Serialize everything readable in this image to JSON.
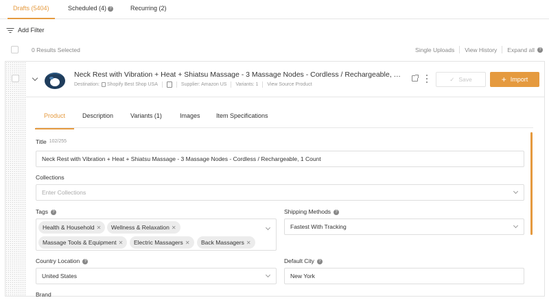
{
  "top_tabs": [
    {
      "label": "Drafts (5404)"
    },
    {
      "label": "Scheduled (4)"
    },
    {
      "label": "Recurring (2)"
    }
  ],
  "filter": {
    "label": "Add Filter"
  },
  "selection": {
    "results_text": "0 Results Selected",
    "links": [
      "Single Uploads",
      "View History",
      "Expand all"
    ]
  },
  "product": {
    "title": "Neck Rest with Vibration + Heat + Shiatsu Massage - 3 Massage Nodes - Cordless / Rechargeable, 1 C...",
    "destination_label": "Destination:",
    "destination_value": "Shopify Best Shop USA",
    "supplier": "Supplier: Amazon US",
    "variants": "Variants: 1",
    "view_source": "View Source Product",
    "save_label": "Save",
    "import_label": "Import"
  },
  "inner_tabs": [
    "Product",
    "Description",
    "Variants (1)",
    "Images",
    "Item Specifications"
  ],
  "form": {
    "title_label": "Title",
    "title_counter": "102/255",
    "title_value": "Neck Rest with Vibration + Heat + Shiatsu Massage - 3 Massage Nodes - Cordless / Rechargeable, 1 Count",
    "collections_label": "Collections",
    "collections_placeholder": "Enter Collections",
    "tags_label": "Tags",
    "tags": [
      "Health & Household",
      "Wellness & Relaxation",
      "Massage Tools & Equipment",
      "Electric Massagers",
      "Back Massagers"
    ],
    "shipping_label": "Shipping Methods",
    "shipping_value": "Fastest With Tracking",
    "country_label": "Country Location",
    "country_value": "United States",
    "city_label": "Default City",
    "city_value": "New York",
    "brand_label": "Brand"
  },
  "colors": {
    "accent": "#e59a3f",
    "border": "#dedede"
  },
  "icons": [
    "help-icon",
    "filter-icon",
    "chevron-down-icon",
    "shop-icon",
    "note-icon",
    "external-link-icon",
    "kebab-icon",
    "check-icon",
    "plus-icon",
    "close-icon"
  ]
}
